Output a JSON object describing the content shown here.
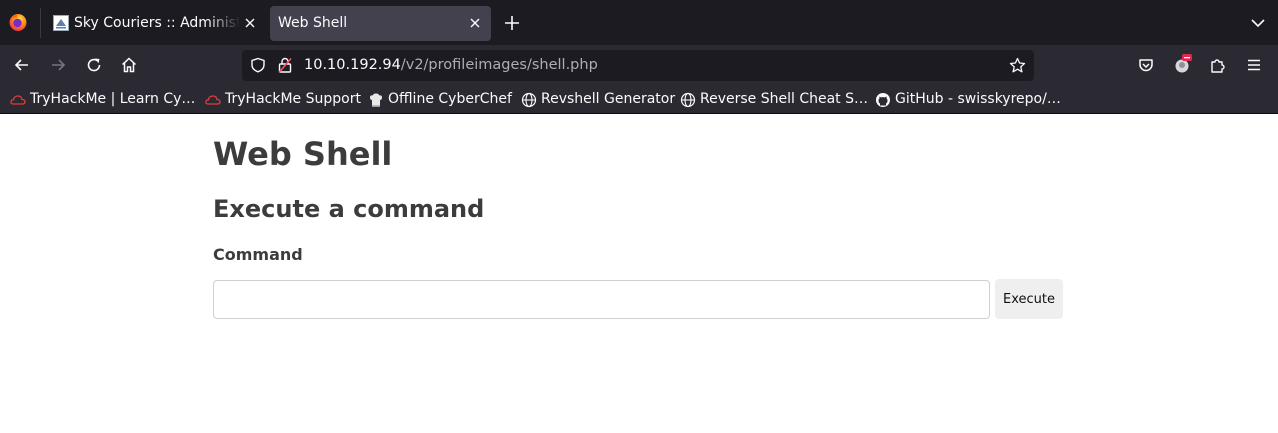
{
  "tabs": [
    {
      "title": "Sky Couriers :: Administra",
      "favicon": "sky-couriers-logo-icon",
      "active": false
    },
    {
      "title": "Web Shell",
      "active": true
    }
  ],
  "navbar": {
    "url_host": "10.10.192.94",
    "url_path": "/v2/profileimages/shell.php"
  },
  "bookmarks": [
    {
      "label": "TryHackMe | Learn Cy…",
      "icon": "tryhackme-icon"
    },
    {
      "label": "TryHackMe Support",
      "icon": "tryhackme-icon"
    },
    {
      "label": "Offline CyberChef",
      "icon": "cyberchef-icon"
    },
    {
      "label": "Revshell Generator",
      "icon": "globe-icon"
    },
    {
      "label": "Reverse Shell Cheat S…",
      "icon": "globe-icon"
    },
    {
      "label": "GitHub - swisskyrepo/…",
      "icon": "github-icon"
    }
  ],
  "page": {
    "title": "Web Shell",
    "section_title": "Execute a command",
    "field_label": "Command",
    "input_value": "",
    "execute_label": "Execute"
  },
  "colors": {
    "tabstrip_bg": "#1c1b22",
    "toolbar_bg": "#2b2a33",
    "active_tab_bg": "#42414d",
    "heading_text": "#3c3c3c",
    "button_bg": "#efefef"
  }
}
